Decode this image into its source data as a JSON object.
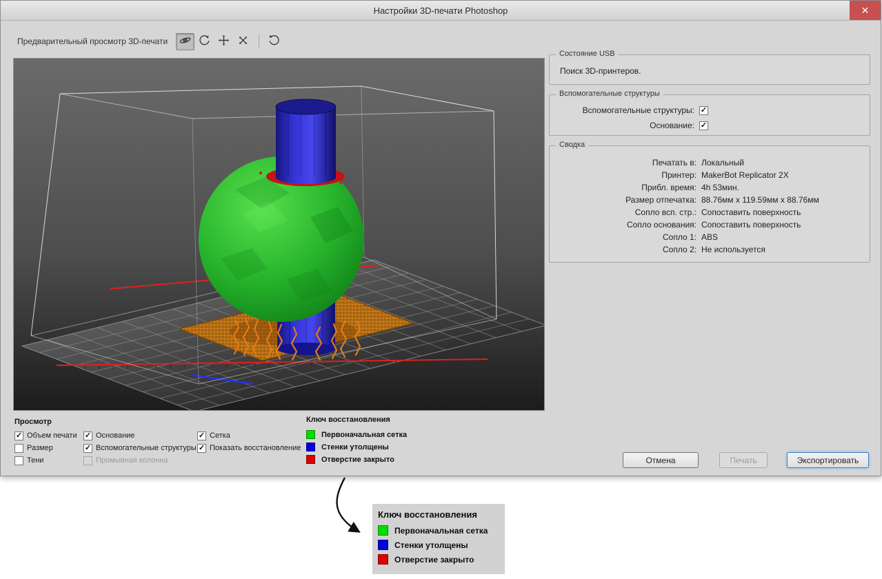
{
  "ui": {
    "check_glyph": "✓"
  },
  "window": {
    "title": "Настройки 3D-печати Photoshop",
    "close_glyph": "✕"
  },
  "toolbar": {
    "label": "Предварительный просмотр 3D-печати"
  },
  "usb": {
    "title": "Состояние USB",
    "status": "Поиск 3D-принтеров."
  },
  "supports_group": {
    "title": "Вспомогательные структуры",
    "rows": [
      {
        "label": "Вспомогательные структуры:",
        "checked": true
      },
      {
        "label": "Основание:",
        "checked": true
      }
    ]
  },
  "summary": {
    "title": "Сводка",
    "rows": [
      {
        "key": "Печатать в:",
        "value": "Локальный"
      },
      {
        "key": "Принтер:",
        "value": "MakerBot Replicator 2X"
      },
      {
        "key": "Прибл. время:",
        "value": "4h 53мин."
      },
      {
        "key": "Размер отпечатка:",
        "value": "88.76мм x 119.59мм x 88.76мм"
      },
      {
        "key": "Сопло всп. стр.:",
        "value": "Сопоставить поверхность"
      },
      {
        "key": "Сопло основания:",
        "value": "Сопоставить поверхность"
      },
      {
        "key": "Сопло 1:",
        "value": "ABS"
      },
      {
        "key": "Сопло 2:",
        "value": "Не используется"
      }
    ]
  },
  "view": {
    "title": "Просмотр",
    "col1": [
      {
        "label": "Объем печати",
        "checked": true
      },
      {
        "label": "Размер",
        "checked": false
      },
      {
        "label": "Тени",
        "checked": false
      }
    ],
    "col2": [
      {
        "label": "Основание",
        "checked": true
      },
      {
        "label": "Вспомогательные структуры",
        "checked": true
      },
      {
        "label": "Промывная колонна",
        "checked": false,
        "disabled": true
      }
    ],
    "col3": [
      {
        "label": "Сетка",
        "checked": true
      },
      {
        "label": "Показать восстановление",
        "checked": true
      }
    ]
  },
  "legend": {
    "title": "Ключ восстановления",
    "items": [
      {
        "label": "Первоначальная сетка",
        "color": "#00dd00"
      },
      {
        "label": "Стенки утолщены",
        "color": "#0000dd"
      },
      {
        "label": "Отверстие закрыто",
        "color": "#dd0000"
      }
    ]
  },
  "buttons": {
    "cancel": "Отмена",
    "print": "Печать",
    "export": "Экспортировать"
  },
  "callout": {
    "title": "Ключ восстановления",
    "items": [
      {
        "label": "Первоначальная сетка",
        "color": "#00dd00"
      },
      {
        "label": "Стенки утолщены",
        "color": "#0000dd"
      },
      {
        "label": "Отверстие закрыто",
        "color": "#dd0000"
      }
    ]
  }
}
